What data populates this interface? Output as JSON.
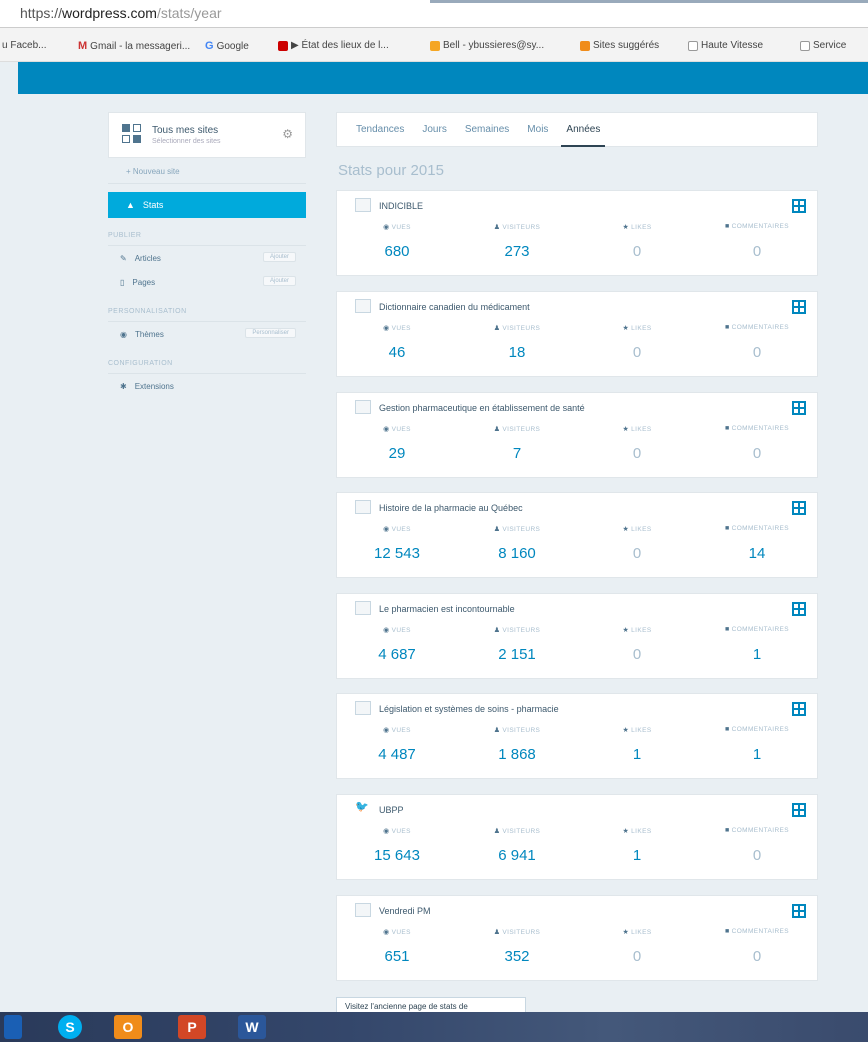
{
  "browser": {
    "url_scheme": "https://",
    "url_host": "wordpress.com",
    "url_path": "/stats/year",
    "bookmarks": [
      {
        "label": "u Faceb...",
        "icon": "facebook-icon"
      },
      {
        "label": "Gmail - la messageri...",
        "icon": "gmail-icon"
      },
      {
        "label": "Google",
        "icon": "google-icon"
      },
      {
        "label": "▶ État des lieux de l...",
        "icon": "youtube-icon"
      },
      {
        "label": "Bell - ybussieres@sy...",
        "icon": "bell-icon"
      },
      {
        "label": "Sites suggérés",
        "icon": "sites-icon"
      },
      {
        "label": "Haute Vitesse",
        "icon": "doc-icon"
      },
      {
        "label": "Service",
        "icon": "doc-icon"
      }
    ]
  },
  "sidebar": {
    "site_title": "Tous mes sites",
    "site_sub": "Sélectionner des sites",
    "add_site": "+ Nouveau site",
    "active_item": "Stats",
    "section_publish": "PUBLIER",
    "publish_items": [
      {
        "label": "Articles",
        "badge": "Ajouter"
      },
      {
        "label": "Pages",
        "badge": "Ajouter"
      }
    ],
    "section_personalize": "PERSONNALISATION",
    "personalize_items": [
      {
        "label": "Thèmes",
        "badge": "Personnaliser"
      }
    ],
    "section_config": "CONFIGURATION",
    "config_items": [
      {
        "label": "Extensions"
      }
    ]
  },
  "tabs": [
    "Tendances",
    "Jours",
    "Semaines",
    "Mois",
    "Années"
  ],
  "active_tab": "Années",
  "page_title": "Stats pour 2015",
  "labels": {
    "views": "VUES",
    "visitors": "VISITEURS",
    "likes": "LIKES",
    "comments": "COMMENTAIRES"
  },
  "sites": [
    {
      "name": "INDICIBLE",
      "views": "680",
      "visitors": "273",
      "likes": "0",
      "comments": "0",
      "icon": "site-icon"
    },
    {
      "name": "Dictionnaire canadien du médicament",
      "views": "46",
      "visitors": "18",
      "likes": "0",
      "comments": "0",
      "icon": "site-icon"
    },
    {
      "name": "Gestion pharmaceutique en établissement de santé",
      "views": "29",
      "visitors": "7",
      "likes": "0",
      "comments": "0",
      "icon": "site-icon"
    },
    {
      "name": "Histoire de la pharmacie au Québec",
      "views": "12 543",
      "visitors": "8 160",
      "likes": "0",
      "comments": "14",
      "icon": "site-icon"
    },
    {
      "name": "Le pharmacien est incontournable",
      "views": "4 687",
      "visitors": "2 151",
      "likes": "0",
      "comments": "1",
      "icon": "site-icon"
    },
    {
      "name": "Législation et systèmes de soins - pharmacie",
      "views": "4 487",
      "visitors": "1 868",
      "likes": "1",
      "comments": "1",
      "icon": "site-icon"
    },
    {
      "name": "UBPP",
      "views": "15 643",
      "visitors": "6 941",
      "likes": "1",
      "comments": "0",
      "icon": "bird-icon"
    },
    {
      "name": "Vendredi PM",
      "views": "651",
      "visitors": "352",
      "likes": "0",
      "comments": "0",
      "icon": "site-icon"
    }
  ],
  "old_stats_button": "Visitez l'ancienne page de stats de",
  "taskbar": [
    "windows-start-icon",
    "skype-icon",
    "outlook-icon",
    "powerpoint-icon",
    "word-icon"
  ]
}
